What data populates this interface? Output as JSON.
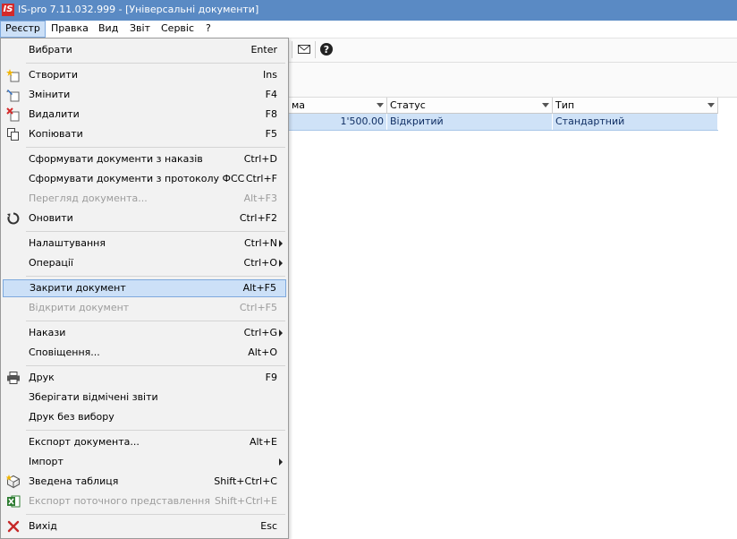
{
  "window": {
    "title": "IS-pro 7.11.032.999 - [Універсальні документи]",
    "logo": "IS"
  },
  "menubar": {
    "items": [
      "Реєстр",
      "Правка",
      "Вид",
      "Звіт",
      "Сервіс",
      "?"
    ]
  },
  "toolbar": {
    "icons": [
      "envelope-icon",
      "help-icon"
    ]
  },
  "grid": {
    "columns": [
      {
        "label": "ма"
      },
      {
        "label": "Статус"
      },
      {
        "label": "Тип"
      }
    ],
    "rows": [
      {
        "amount": "1'500.00",
        "status": "Відкритий",
        "type": "Стандартний"
      }
    ]
  },
  "dropdown": {
    "items": [
      {
        "label": "Вибрати",
        "shortcut": "Enter",
        "enabled": true
      },
      {
        "label": "Створити",
        "shortcut": "Ins",
        "icon": "create-icon",
        "enabled": true
      },
      {
        "label": "Змінити",
        "shortcut": "F4",
        "icon": "edit-icon",
        "enabled": true
      },
      {
        "label": "Видалити",
        "shortcut": "F8",
        "icon": "delete-icon",
        "enabled": true
      },
      {
        "label": "Копіювати",
        "shortcut": "F5",
        "icon": "copy-icon",
        "enabled": true
      },
      {
        "label": "Сформувати документи з наказів",
        "shortcut": "Ctrl+D",
        "enabled": true
      },
      {
        "label": "Сформувати документи з протоколу ФСС",
        "shortcut": "Ctrl+F",
        "enabled": true
      },
      {
        "label": "Перегляд документа...",
        "shortcut": "Alt+F3",
        "enabled": false
      },
      {
        "label": "Оновити",
        "shortcut": "Ctrl+F2",
        "icon": "refresh-icon",
        "enabled": true
      },
      {
        "label": "Налаштування",
        "shortcut": "Ctrl+N",
        "submenu": true,
        "enabled": true
      },
      {
        "label": "Операції",
        "shortcut": "Ctrl+O",
        "submenu": true,
        "enabled": true
      },
      {
        "label": "Закрити документ",
        "shortcut": "Alt+F5",
        "enabled": true,
        "highlighted": true
      },
      {
        "label": "Відкрити документ",
        "shortcut": "Ctrl+F5",
        "enabled": false
      },
      {
        "label": "Накази",
        "shortcut": "Ctrl+G",
        "submenu": true,
        "enabled": true
      },
      {
        "label": "Сповіщення...",
        "shortcut": "Alt+O",
        "enabled": true
      },
      {
        "label": "Друк",
        "shortcut": "F9",
        "icon": "printer-icon",
        "enabled": true
      },
      {
        "label": "Зберігати відмічені звіти",
        "shortcut": "",
        "enabled": true
      },
      {
        "label": "Друк без вибору",
        "shortcut": "",
        "enabled": true
      },
      {
        "label": "Експорт документа...",
        "shortcut": "Alt+E",
        "enabled": true
      },
      {
        "label": "Імпорт",
        "shortcut": "",
        "submenu": true,
        "enabled": true
      },
      {
        "label": "Зведена таблиця",
        "shortcut": "Shift+Ctrl+C",
        "icon": "pivot-table-icon",
        "enabled": true
      },
      {
        "label": "Експорт поточного представлення",
        "shortcut": "Shift+Ctrl+E",
        "icon": "excel-export-icon",
        "enabled": false
      },
      {
        "label": "Вихід",
        "shortcut": "Esc",
        "icon": "exit-icon",
        "enabled": true
      }
    ]
  },
  "colors": {
    "titlebar": "#5a8ac4",
    "highlight": "#cce0f7",
    "selected_row": "#cfe2f7",
    "logo": "#d42a2a"
  }
}
